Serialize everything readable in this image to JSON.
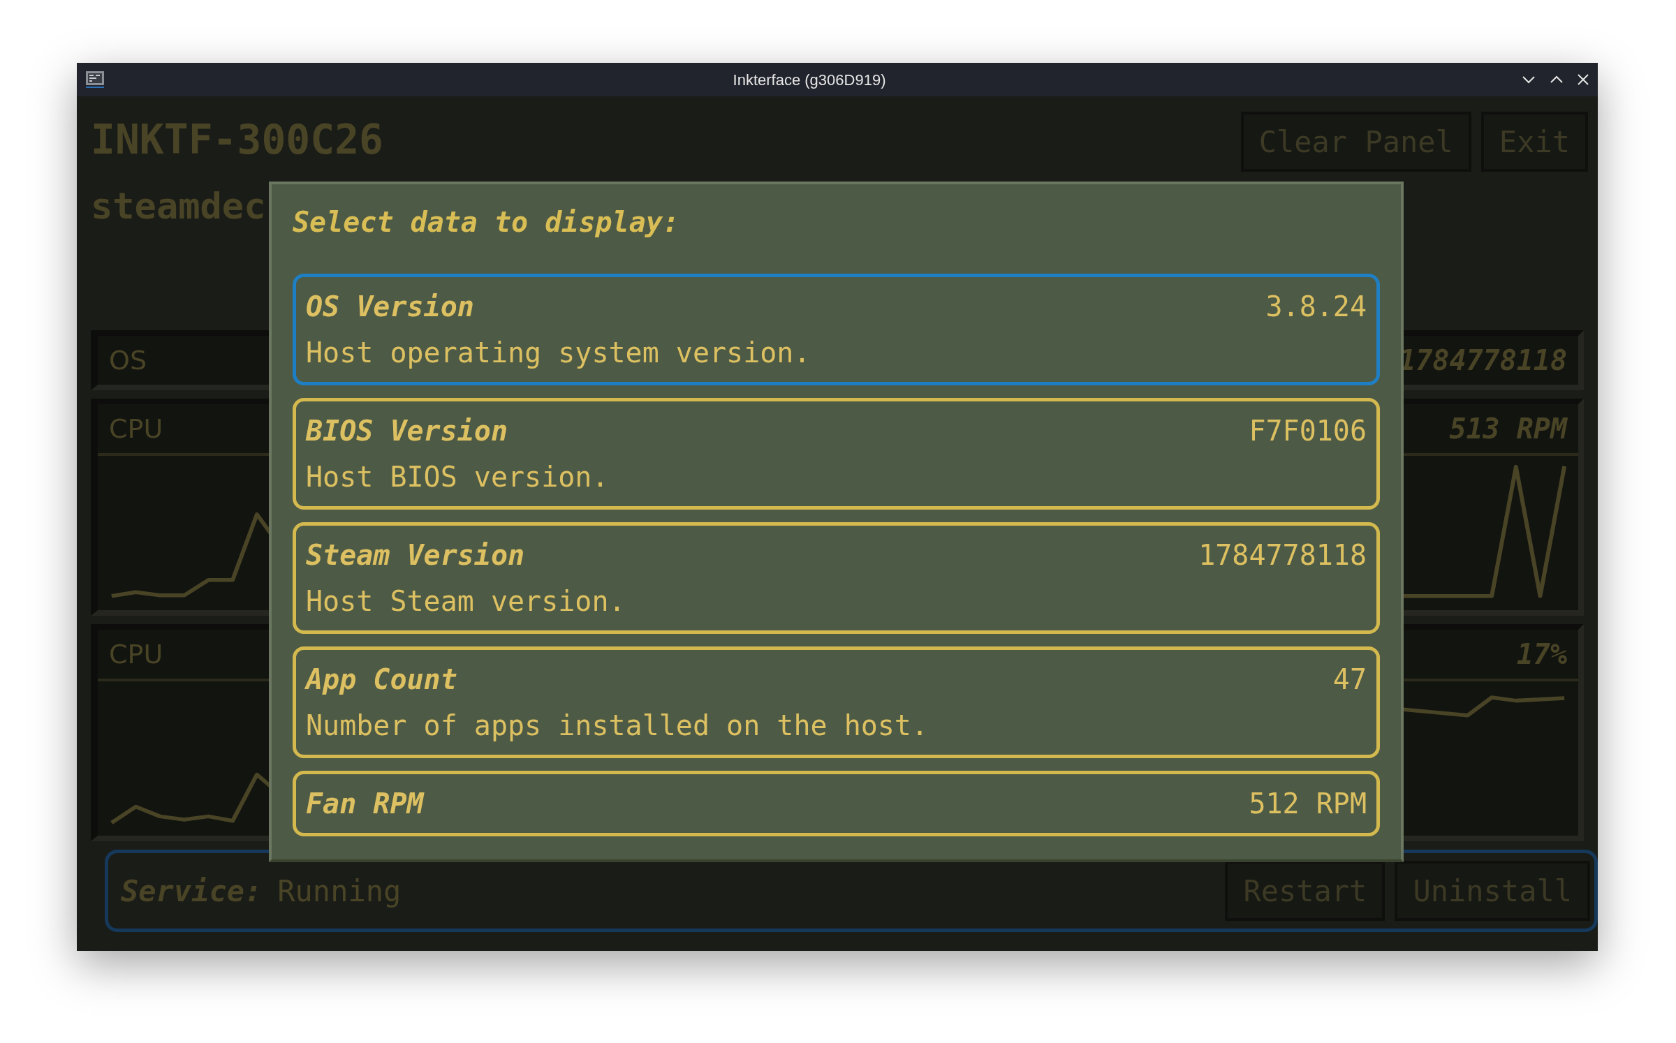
{
  "window": {
    "title": "Inkterface (g306D919)"
  },
  "header": {
    "title": "INKTF-300C26",
    "subtitle": "steamdec",
    "buttons": [
      "Clear Panel",
      "Exit"
    ]
  },
  "panels": [
    {
      "kind": "text",
      "label": "OS",
      "value": "1784778118"
    },
    {
      "kind": "chart",
      "label": "CPU",
      "value": "513 RPM"
    },
    {
      "kind": "chart",
      "label": "CPU",
      "value": "17%"
    }
  ],
  "status": {
    "label": "Service:",
    "value": "Running",
    "buttons": [
      "Restart",
      "Uninstall"
    ]
  },
  "dialog": {
    "title": "Select data to display:",
    "options": [
      {
        "name": "OS Version",
        "value": "3.8.24",
        "description": "Host operating system version.",
        "selected": true
      },
      {
        "name": "BIOS Version",
        "value": "F7F0106",
        "description": "Host BIOS version.",
        "selected": false
      },
      {
        "name": "Steam Version",
        "value": "1784778118",
        "description": "Host Steam version.",
        "selected": false
      },
      {
        "name": "App Count",
        "value": "47",
        "description": "Number of apps installed on the host.",
        "selected": false
      },
      {
        "name": "Fan RPM",
        "value": "512 RPM",
        "selected": false
      }
    ]
  }
}
